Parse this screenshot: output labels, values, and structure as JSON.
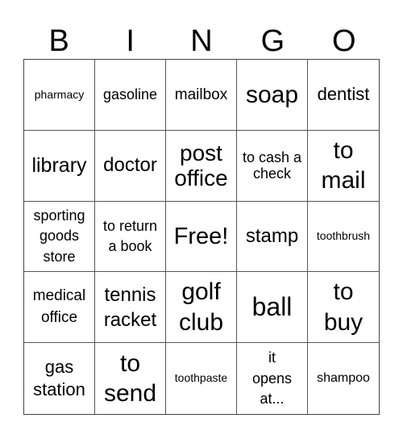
{
  "header": {
    "letters": [
      "B",
      "I",
      "N",
      "G",
      "O"
    ]
  },
  "card": {
    "cells": [
      {
        "label": "pharmacy"
      },
      {
        "label": "gasoline"
      },
      {
        "label": "mailbox"
      },
      {
        "label": "soap"
      },
      {
        "label": "dentist"
      },
      {
        "label": "library"
      },
      {
        "label": "doctor"
      },
      {
        "label": "post office"
      },
      {
        "label": "to cash a check"
      },
      {
        "label": "to mail"
      },
      {
        "label": "sporting goods store"
      },
      {
        "label": "to return a book"
      },
      {
        "label": "Free!",
        "free_space": true
      },
      {
        "label": "stamp"
      },
      {
        "label": "toothbrush"
      },
      {
        "label": "medical office"
      },
      {
        "label": "tennis racket"
      },
      {
        "label": "golf club"
      },
      {
        "label": "ball"
      },
      {
        "label": "to buy"
      },
      {
        "label": "gas station"
      },
      {
        "label": "to send"
      },
      {
        "label": "toothpaste"
      },
      {
        "label": "it opens at..."
      },
      {
        "label": "shampoo"
      }
    ]
  }
}
